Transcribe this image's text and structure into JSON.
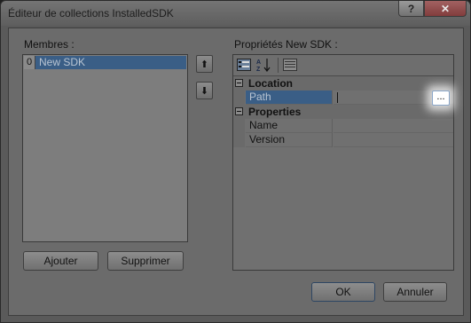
{
  "window": {
    "title": "Éditeur de collections InstalledSDK",
    "help_label": "?",
    "close_label": "✕"
  },
  "members": {
    "label": "Membres :",
    "items": [
      {
        "index": "0",
        "name": "New SDK"
      }
    ]
  },
  "move_buttons": {
    "up": "⬆",
    "down": "⬇"
  },
  "buttons": {
    "add": "Ajouter",
    "remove": "Supprimer",
    "ok": "OK",
    "cancel": "Annuler"
  },
  "properties": {
    "label": "Propriétés New SDK :",
    "toolbar": [
      "categorized-icon",
      "alphabetical-icon",
      "property-pages-icon"
    ],
    "categories": [
      {
        "name": "Location",
        "rows": [
          {
            "name": "Path",
            "value": ""
          }
        ]
      },
      {
        "name": "Properties",
        "rows": [
          {
            "name": "Name",
            "value": ""
          },
          {
            "name": "Version",
            "value": ""
          }
        ]
      }
    ],
    "ellipsis_label": "..."
  },
  "colors": {
    "selection": "#3a5e86",
    "dialog": "#6b6b6b"
  }
}
